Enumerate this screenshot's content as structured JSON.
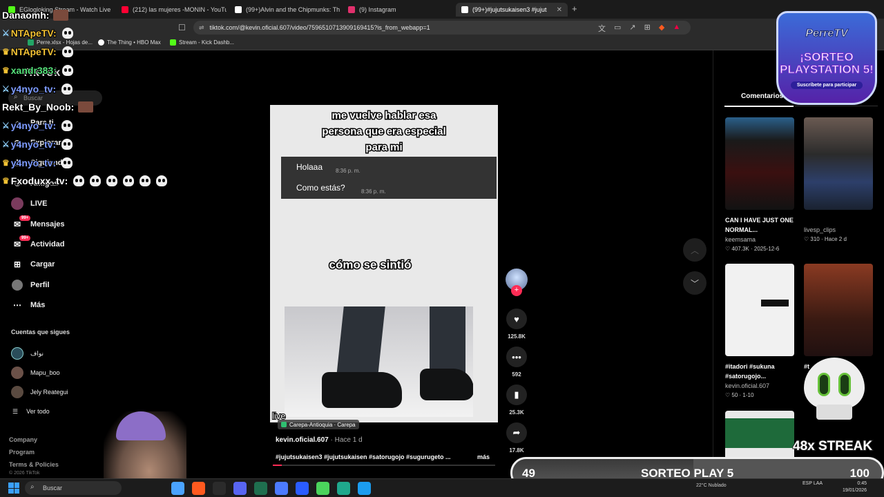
{
  "tabs": [
    {
      "label": "EGlogloking Stream - Watch Live on",
      "color": "#53fc18"
    },
    {
      "label": "(212) las mujeres -MONIN - YouTube",
      "color": "#ff0033"
    },
    {
      "label": "(99+)Alvin and the Chipmunks: Theo",
      "color": "#ffffff"
    },
    {
      "label": "(9) Instagram",
      "color": "#e1306c"
    },
    {
      "label": "(99+)#jujutsukaisen3 #jujutsuka",
      "color": "#ffffff",
      "active": true
    }
  ],
  "url": "tiktok.com/@kevin.oficial.607/video/7596510713909169415?is_from_webapp=1",
  "bookmarks": [
    "Perre.xlsx - Hojas de...",
    "The Thing • HBO Max",
    "Stream - Kick Dashb..."
  ],
  "tiktok": {
    "logo": "TikTok",
    "search_placeholder": "Buscar",
    "nav": [
      {
        "label": "Para ti",
        "icon": "home-icon"
      },
      {
        "label": "Explorar",
        "icon": "compass-icon"
      },
      {
        "label": "Siguiendo",
        "icon": "following-icon"
      },
      {
        "label": "Amigos",
        "icon": "friends-icon"
      },
      {
        "label": "LIVE",
        "icon": "live-icon"
      },
      {
        "label": "Mensajes",
        "icon": "messages-icon",
        "badge": "99+"
      },
      {
        "label": "Actividad",
        "icon": "activity-icon",
        "badge": "99+"
      },
      {
        "label": "Cargar",
        "icon": "upload-icon"
      },
      {
        "label": "Perfil",
        "icon": "profile-icon"
      },
      {
        "label": "Más",
        "icon": "more-icon"
      }
    ],
    "following_title": "Cuentas que sigues",
    "following": [
      "نواف",
      "Mapu_boo",
      "Jely Reategui"
    ],
    "see_all": "Ver todo",
    "footer": [
      "Company",
      "Program",
      "Terms & Policies"
    ],
    "copyright": "© 2026 TikTok"
  },
  "video": {
    "caption_top": [
      "me vuelve hablar esa",
      "persona que era especial",
      "para mi"
    ],
    "chat": [
      {
        "text": "Holaaa",
        "time": "8:36 p. m."
      },
      {
        "text": "Como estás?",
        "time": "8:36 p. m."
      }
    ],
    "caption_mid": "cómo se sintió",
    "live_tag": "live",
    "location": "Carepa-Antioquia · Carepa",
    "author": "kevin.oficial.607",
    "ago": "· Hace 1 d",
    "hashtags": "#jujutsukaisen3 #jujutsukaisen #satorugojo #sugurugeto ...",
    "more": "más",
    "progress": 0.04
  },
  "actions": [
    {
      "icon": "heart-icon",
      "count": "125.8K"
    },
    {
      "icon": "comment-icon",
      "count": "592"
    },
    {
      "icon": "bookmark-icon",
      "count": "25.3K"
    },
    {
      "icon": "share-icon",
      "count": "17.8K"
    }
  ],
  "right": {
    "tab_label": "Comentarios",
    "cards": [
      {
        "title": "CAN I HAVE JUST ONE NORMAL...",
        "user": "keemsama",
        "views": "407.3K",
        "date": "2025-12-6"
      },
      {
        "title": "",
        "user": "livesp_clips",
        "views": "310",
        "date": "Hace 2 d"
      },
      {
        "title": "#itadori #sukuna #satorugojo...",
        "user": "kevin.oficial.607",
        "views": "50",
        "date": "1-10"
      },
      {
        "title": "#t",
        "user": "",
        "views": "",
        "date": ""
      }
    ]
  },
  "overlay": {
    "chat": [
      {
        "user": "Danaomh:",
        "color": "#ffffff",
        "emotes": 0
      },
      {
        "user": "NTApeTV:",
        "color": "#f3c234",
        "emotes": 1
      },
      {
        "user": "NTApeTV:",
        "color": "#f3c234",
        "emotes": 1
      },
      {
        "user": "xandr383:",
        "color": "#55e27a",
        "emotes": 1
      },
      {
        "user": "y4nyo_tv:",
        "color": "#7d9bff",
        "emotes": 1
      },
      {
        "user": "Rekt_By_Noob:",
        "color": "#ffffff",
        "emotes": 0
      },
      {
        "user": "y4nyo_tv:",
        "color": "#7d9bff",
        "emotes": 1
      },
      {
        "user": "y4nyo_tv:",
        "color": "#7d9bff",
        "emotes": 1
      },
      {
        "user": "y4nyo_tv:",
        "color": "#7d9bff",
        "emotes": 1
      },
      {
        "user": "Fxoduxx_tv:",
        "color": "#ffffff",
        "emotes": 6
      }
    ],
    "perretv": {
      "brand": "PerreTV",
      "line1": "¡SORTEO",
      "line2": "PLAYSTATION 5!",
      "sub": "Suscríbete para participar"
    },
    "streak": "48x STREAK",
    "sorteo": {
      "current": "49",
      "label": "SORTEO PLAY 5",
      "goal": "100"
    }
  },
  "taskbar": {
    "search": "Buscar",
    "icons": [
      "#4aa3ff",
      "#ff5a1f",
      "#2b2b2b",
      "#5865f2",
      "#1f6f4f",
      "#4c7bff",
      "#2a5cff",
      "#4bd35c",
      "#1fa88c",
      "#1b9df0"
    ],
    "weather": "22°C Nublado",
    "lang": "ESP LAA",
    "time": "0:45",
    "date": "19/01/2026"
  }
}
